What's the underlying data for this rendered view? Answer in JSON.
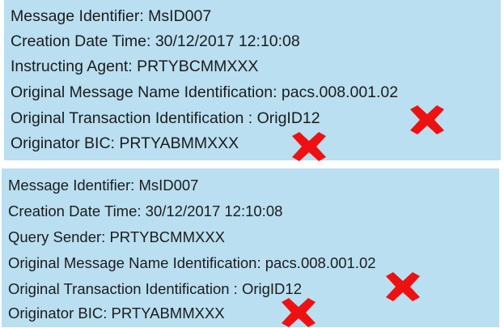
{
  "top_panel": {
    "message_identifier": "Message Identifier: MsID007",
    "creation_date_time": "Creation Date Time: 30/12/2017  12:10:08",
    "instructing_agent": "Instructing Agent: PRTYBCMMXXX",
    "original_message_name": "Original Message Name Identification: pacs.008.001.02",
    "original_transaction": "Original Transaction Identification : OrigID12",
    "originator_bic": "Originator BIC: PRTYABMMXXX"
  },
  "bottom_panel": {
    "message_identifier": "Message Identifier: MsID007",
    "creation_date_time": "Creation Date Time: 30/12/2017 12:10:08",
    "query_sender": "Query Sender: PRTYBCMMXXX",
    "original_message_name": "Original Message  Name Identification: pacs.008.001.02",
    "original_transaction": "Original Transaction Identification : OrigID12",
    "originator_bic": "Originator BIC: PRTYABMMXXX"
  },
  "icons": {
    "cross_mark": "red-cross-icon",
    "cross_color": "#ee1111"
  },
  "colors": {
    "panel_background": "#b9dff0",
    "text": "#1c1c1c"
  }
}
